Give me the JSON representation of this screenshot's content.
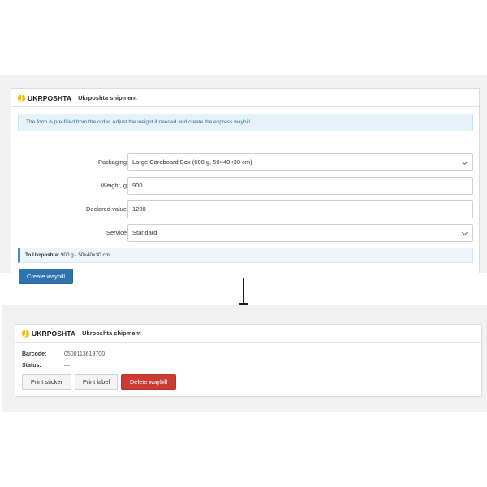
{
  "brand": {
    "name": "UKRPOSHTA",
    "icon": "ukrposhta-logo-icon",
    "accent": "#f5b800"
  },
  "before": {
    "panel_title": "Ukrposhta shipment",
    "alert_text": "The form is pre-filled from the order. Adjust the weight if needed and create the express waybill.",
    "fields": {
      "packaging": {
        "label": "Packaging",
        "value": "Large Cardboard Box (600 g, 50×40×30 cm)"
      },
      "weight": {
        "label": "Weight, g",
        "value": "900"
      },
      "declared_value": {
        "label": "Declared value",
        "value": "1200"
      },
      "service": {
        "label": "Service",
        "value": "Standard"
      }
    },
    "summary_label": "To Ukrposhta:",
    "summary_value": "900 g · 50×40×30 cm",
    "create_button": "Create waybill",
    "colors": {
      "primary": "#2f73ae",
      "alert_bg": "#e5f2f9"
    }
  },
  "after": {
    "panel_title": "Ukrposhta shipment",
    "barcode_label": "Barcode:",
    "barcode_value": "0500113619700",
    "status_label": "Status:",
    "status_value": "—",
    "print_sticker_button": "Print sticker",
    "print_label_button": "Print label",
    "delete_button": "Delete waybill",
    "colors": {
      "danger": "#cb3a34"
    }
  }
}
